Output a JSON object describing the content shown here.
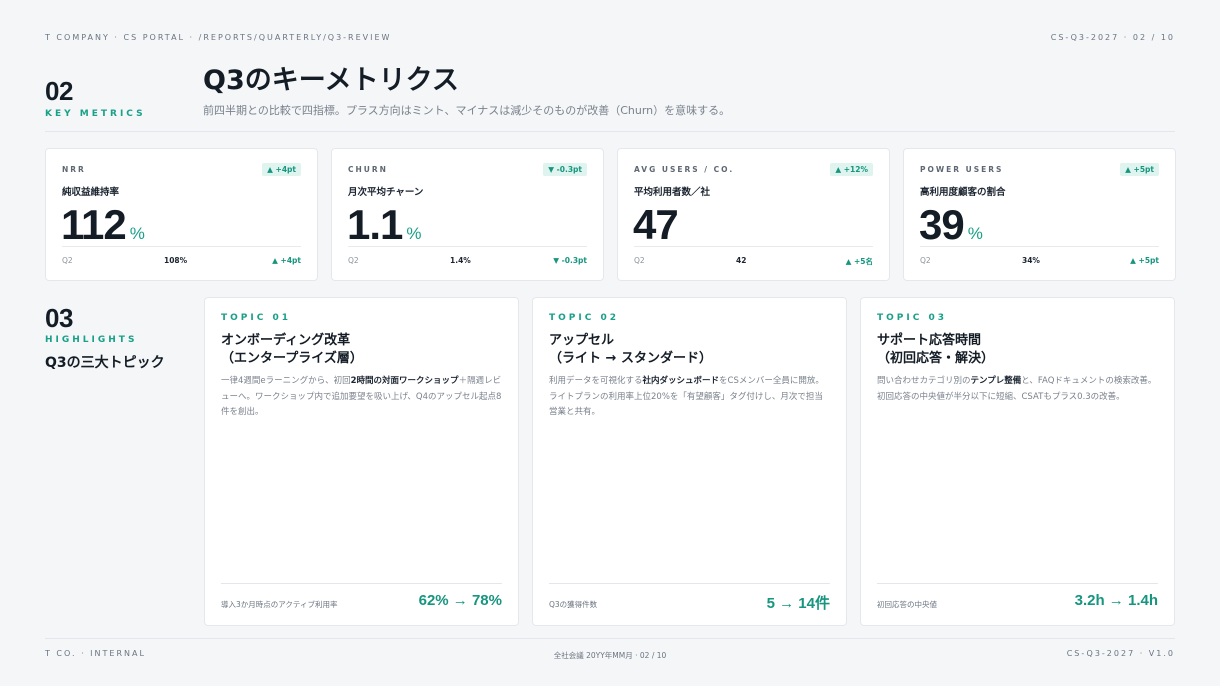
{
  "header": {
    "breadcrumb": "T COMPANY · CS PORTAL · /REPORTS/QUARTERLY/Q3-REVIEW",
    "page_ref": "CS-Q3-2027 · 02 / 10"
  },
  "section_metrics": {
    "number": "02",
    "label": "KEY METRICS",
    "title": "Q3のキーメトリクス",
    "subtitle": "前四半期との比較で四指標。プラス方向はミント、マイナスは減少そのものが改善（Churn）を意味する。"
  },
  "metrics": [
    {
      "code": "NRR",
      "badge": "▲ +4pt",
      "name": "純収益維持率",
      "value": "112",
      "unit": "%",
      "prev_label": "Q2",
      "prev_value": "108%",
      "delta": "▲ +4pt"
    },
    {
      "code": "CHURN",
      "badge": "▼ -0.3pt",
      "name": "月次平均チャーン",
      "value": "1.1",
      "unit": "%",
      "prev_label": "Q2",
      "prev_value": "1.4%",
      "delta": "▼ -0.3pt"
    },
    {
      "code": "AVG USERS / CO.",
      "badge": "▲ +12%",
      "name": "平均利用者数／社",
      "value": "47",
      "unit": "",
      "prev_label": "Q2",
      "prev_value": "42",
      "delta": "▲ +5名"
    },
    {
      "code": "POWER USERS",
      "badge": "▲ +5pt",
      "name": "高利用度顧客の割合",
      "value": "39",
      "unit": "%",
      "prev_label": "Q2",
      "prev_value": "34%",
      "delta": "▲ +5pt"
    }
  ],
  "section_highlights": {
    "number": "03",
    "label": "HIGHLIGHTS",
    "title": "Q3の三大トピック"
  },
  "topics": [
    {
      "code": "TOPIC 01",
      "title_line1": "オンボーディング改革",
      "title_line2": "（エンタープライズ層）",
      "body_pre": "一律4週間eラーニングから、初回",
      "body_bold": "2時間の対面ワークショップ",
      "body_post": "＋隔週レビューへ。ワークショップ内で追加要望を吸い上げ、Q4のアップセル起点8件を創出。",
      "foot_label": "導入3か月時点のアクティブ利用率",
      "foot_value": "62% → 78%"
    },
    {
      "code": "TOPIC 02",
      "title_line1": "アップセル",
      "title_line2": "（ライト → スタンダード）",
      "body_pre": "利用データを可視化する",
      "body_bold": "社内ダッシュボード",
      "body_post": "をCSメンバー全員に開放。ライトプランの利用率上位20%を「有望顧客」タグ付けし、月次で担当営業と共有。",
      "foot_label": "Q3の獲得件数",
      "foot_value": "5 → 14件"
    },
    {
      "code": "TOPIC 03",
      "title_line1": "サポート応答時間",
      "title_line2": "（初回応答・解決）",
      "body_pre": "問い合わせカテゴリ別の",
      "body_bold": "テンプレ整備",
      "body_post": "と、FAQドキュメントの検索改善。初回応答の中央値が半分以下に短縮、CSATもプラス0.3の改善。",
      "foot_label": "初回応答の中央値",
      "foot_value": "3.2h → 1.4h"
    }
  ],
  "footer": {
    "left": "T CO. · INTERNAL",
    "center": "全社会議 20YY年MM月 · 02 / 10",
    "right": "CS-Q3-2027 · V1.0"
  }
}
